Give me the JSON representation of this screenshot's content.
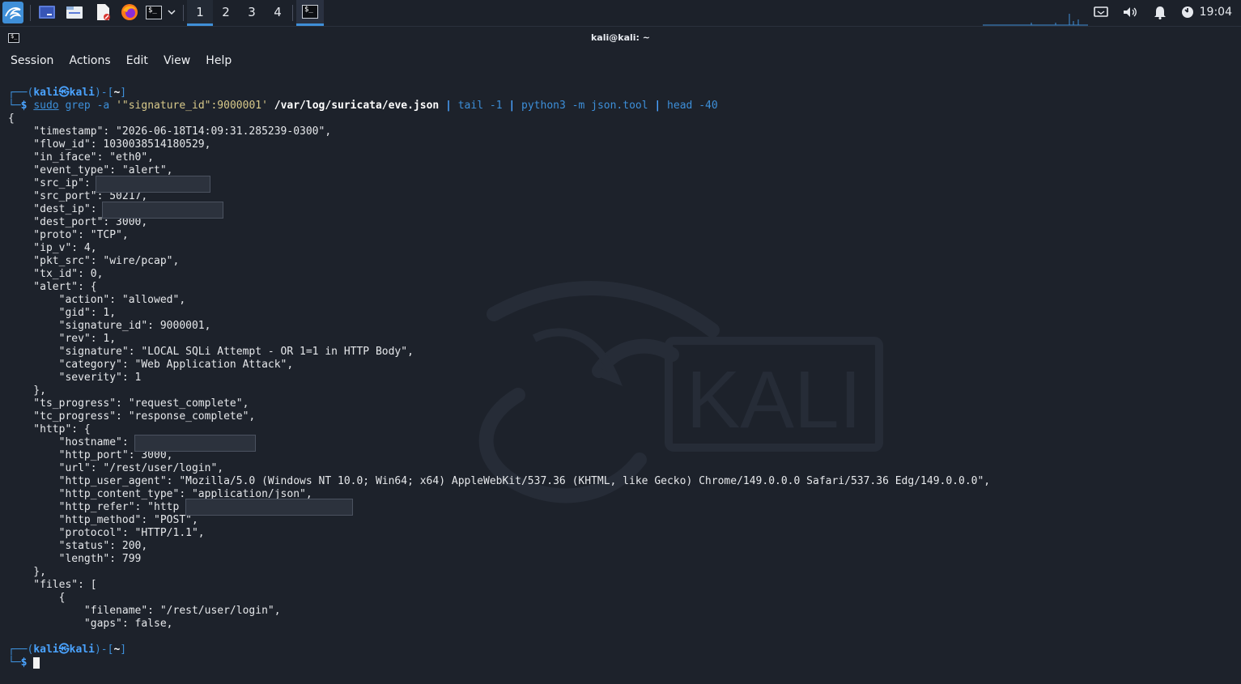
{
  "panel": {
    "workspaces": [
      "1",
      "2",
      "3",
      "4"
    ],
    "active_workspace": "1",
    "clock": "19:04",
    "accent": "#3f8fd8",
    "launchers": [
      "kali-menu-icon",
      "desktop-icon",
      "file-manager-icon",
      "text-editor-icon",
      "firefox-icon",
      "terminal-icon"
    ],
    "tray": [
      "display-icon",
      "volume-icon",
      "notification-bell-icon",
      "power-icon"
    ]
  },
  "window": {
    "title": "kali@kali: ~"
  },
  "menu": {
    "items": [
      "Session",
      "Actions",
      "Edit",
      "View",
      "Help"
    ]
  },
  "terminal": {
    "prompt": {
      "open": "┌──(",
      "user": "kali",
      "at": "㉿",
      "host": "kali",
      "close": ")-[",
      "dir": "~",
      "end": "]",
      "corner": "└─",
      "dollar": "$"
    },
    "command": {
      "sudo": "sudo",
      "grep": "grep",
      "flag_a": "-a",
      "pattern": "'\"signature_id\":9000001'",
      "file": "/var/log/suricata/eve.json",
      "pipe": "|",
      "tail": "tail",
      "tail_arg": "-1",
      "python": "python3",
      "py_args": "-m json.tool",
      "head": "head",
      "head_arg": "-40"
    },
    "output": [
      "{",
      "    \"timestamp\": \"2026-06-18T14:09:31.285239-0300\",",
      "    \"flow_id\": 1030038514180529,",
      "    \"in_iface\": \"eth0\",",
      "    \"event_type\": \"alert\",",
      "    \"src_ip\":",
      "    \"src_port\": 50217,",
      "    \"dest_ip\":",
      "    \"dest_port\": 3000,",
      "    \"proto\": \"TCP\",",
      "    \"ip_v\": 4,",
      "    \"pkt_src\": \"wire/pcap\",",
      "    \"tx_id\": 0,",
      "    \"alert\": {",
      "        \"action\": \"allowed\",",
      "        \"gid\": 1,",
      "        \"signature_id\": 9000001,",
      "        \"rev\": 1,",
      "        \"signature\": \"LOCAL SQLi Attempt - OR 1=1 in HTTP Body\",",
      "        \"category\": \"Web Application Attack\",",
      "        \"severity\": 1",
      "    },",
      "    \"ts_progress\": \"request_complete\",",
      "    \"tc_progress\": \"response_complete\",",
      "    \"http\": {",
      "        \"hostname\":",
      "        \"http_port\": 3000,",
      "        \"url\": \"/rest/user/login\",",
      "        \"http_user_agent\": \"Mozilla/5.0 (Windows NT 10.0; Win64; x64) AppleWebKit/537.36 (KHTML, like Gecko) Chrome/149.0.0.0 Safari/537.36 Edg/149.0.0.0\",",
      "        \"http_content_type\": \"application/json\",",
      "        \"http_refer\": \"http",
      "        \"http_method\": \"POST\",",
      "        \"protocol\": \"HTTP/1.1\",",
      "        \"status\": 200,",
      "        \"length\": 799",
      "    },",
      "    \"files\": [",
      "        {",
      "            \"filename\": \"/rest/user/login\",",
      "            \"gaps\": false,"
    ],
    "wallpaper_text": "KALI"
  }
}
